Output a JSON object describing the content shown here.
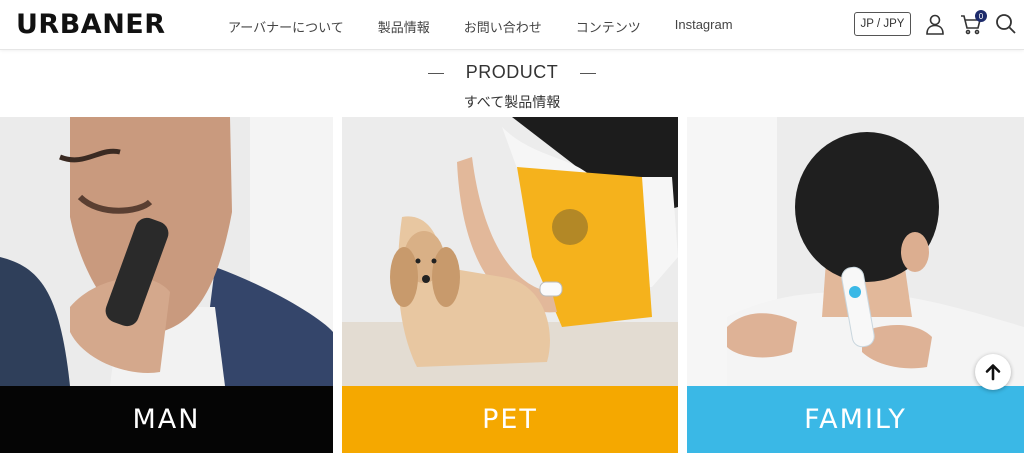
{
  "header": {
    "logo_text": "URBANER",
    "nav": [
      {
        "label": "アーバナーについて"
      },
      {
        "label": "製品情報"
      },
      {
        "label": "お問い合わせ"
      },
      {
        "label": "コンテンツ"
      },
      {
        "label": "Instagram"
      }
    ],
    "lang_label": "JP / JPY",
    "cart_count": "0",
    "icons": [
      "user-icon",
      "cart-icon",
      "search-icon"
    ]
  },
  "section": {
    "title": "PRODUCT",
    "subtitle": "すべて製品情報"
  },
  "cards": [
    {
      "label": "MAN",
      "color": "#050505"
    },
    {
      "label": "PET",
      "color": "#f5a800"
    },
    {
      "label": "FAMILY",
      "color": "#3ab8e6"
    }
  ],
  "colors": {
    "brand_navy": "#1d2b6b",
    "man": "#050505",
    "pet": "#f5a800",
    "family": "#3ab8e6"
  }
}
